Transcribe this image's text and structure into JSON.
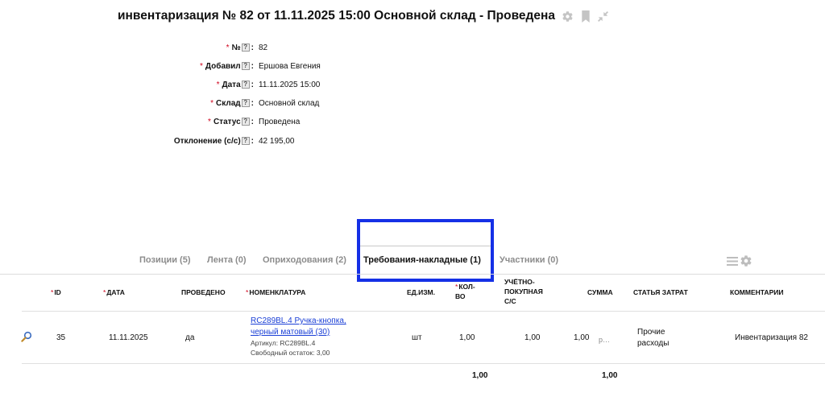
{
  "document": {
    "title": "инвентаризация № 82 от 11.11.2025 15:00 Основной склад - Проведена",
    "icons": [
      "gear-icon",
      "bookmark-icon",
      "collapse-icon"
    ]
  },
  "fields": [
    {
      "label": "№",
      "required": "*",
      "help": "?",
      "value": "82"
    },
    {
      "label": "Добавил",
      "required": "*",
      "help": "?",
      "value": "Ершова Евгения"
    },
    {
      "label": "Дата",
      "required": "*",
      "help": "?",
      "value": "11.11.2025 15:00"
    },
    {
      "label": "Склад",
      "required": "*",
      "help": "?",
      "value": "Основной склад"
    },
    {
      "label": "Статус",
      "required": "*",
      "help": "?",
      "value": "Проведена"
    },
    {
      "label": "Отклонение (с/с)",
      "required": "",
      "help": "?",
      "value": "42 195,00"
    }
  ],
  "tabs": [
    {
      "label": "Позиции (5)",
      "active": false
    },
    {
      "label": "Лента (0)",
      "active": false
    },
    {
      "label": "Оприходования (2)",
      "active": false
    },
    {
      "label": "Требования-накладные (1)",
      "active": true
    },
    {
      "label": "Участники (0)",
      "active": false
    }
  ],
  "table": {
    "headers": {
      "id": "ID",
      "date": "ДАТА",
      "posted": "ПРОВЕДЕНО",
      "nomenclature": "НОМЕНКЛАТУРА",
      "unit": "ЕД.ИЗМ.",
      "qty_line1": "КОЛ-",
      "qty_line2": "ВО",
      "cost_line1": "УЧЁТНО-",
      "cost_line2": "ПОКУПНАЯ",
      "cost_line3": "С/С",
      "sum": "СУММА",
      "expense": "СТАТЬЯ ЗАТРАТ",
      "comment": "КОММЕНТАРИИ",
      "required_mark": "*"
    },
    "rows": [
      {
        "id": "35",
        "date": "11.11.2025",
        "posted": "да",
        "item_link_line1": "RC289BL.4 Ручка-кнопка,",
        "item_link_line2": "черный матовый (30)",
        "item_sku": "Артикул: RC289BL.4",
        "item_stock": "Свободный остаток: 3,00",
        "unit": "шт",
        "qty": "1,00",
        "cost": "1,00",
        "sum": "1,00",
        "sum_suffix": "р…",
        "expense_line1": "Прочие",
        "expense_line2": "расходы",
        "comment": "Инвентаризация 82"
      }
    ],
    "totals": {
      "qty": "1,00",
      "sum": "1,00"
    }
  },
  "colors": {
    "accent": "#1530e6",
    "link": "#1a3fd6",
    "required": "#d0021b"
  }
}
